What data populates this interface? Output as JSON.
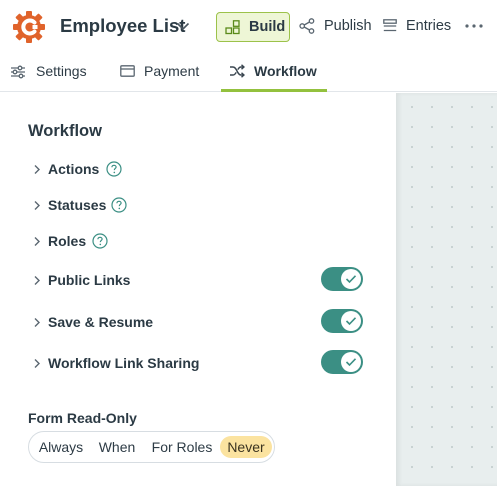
{
  "header": {
    "app_title": "Employee List",
    "build_label": "Build",
    "publish_label": "Publish",
    "entries_label": "Entries",
    "more_label": "···"
  },
  "tabs": [
    {
      "label": "Settings",
      "icon": "sliders-icon",
      "active": false
    },
    {
      "label": "Payment",
      "icon": "card-icon",
      "active": false
    },
    {
      "label": "Workflow",
      "icon": "shuffle-icon",
      "active": true
    }
  ],
  "panel": {
    "title": "Workflow",
    "sections": [
      {
        "label": "Actions",
        "help": true
      },
      {
        "label": "Statuses",
        "help": true
      },
      {
        "label": "Roles",
        "help": true
      },
      {
        "label": "Public Links",
        "toggle": "on"
      },
      {
        "label": "Save & Resume",
        "toggle": "on"
      },
      {
        "label": "Workflow Link Sharing",
        "toggle": "on"
      }
    ],
    "read_only": {
      "label": "Form Read-Only",
      "options": [
        "Always",
        "When",
        "For Roles",
        "Never"
      ],
      "selected": "Never"
    }
  },
  "colors": {
    "accent_green": "#93c13e",
    "toggle_teal": "#3b8f84",
    "selected_option": "#fbe3a0",
    "logo_orange": "#e0632b"
  }
}
